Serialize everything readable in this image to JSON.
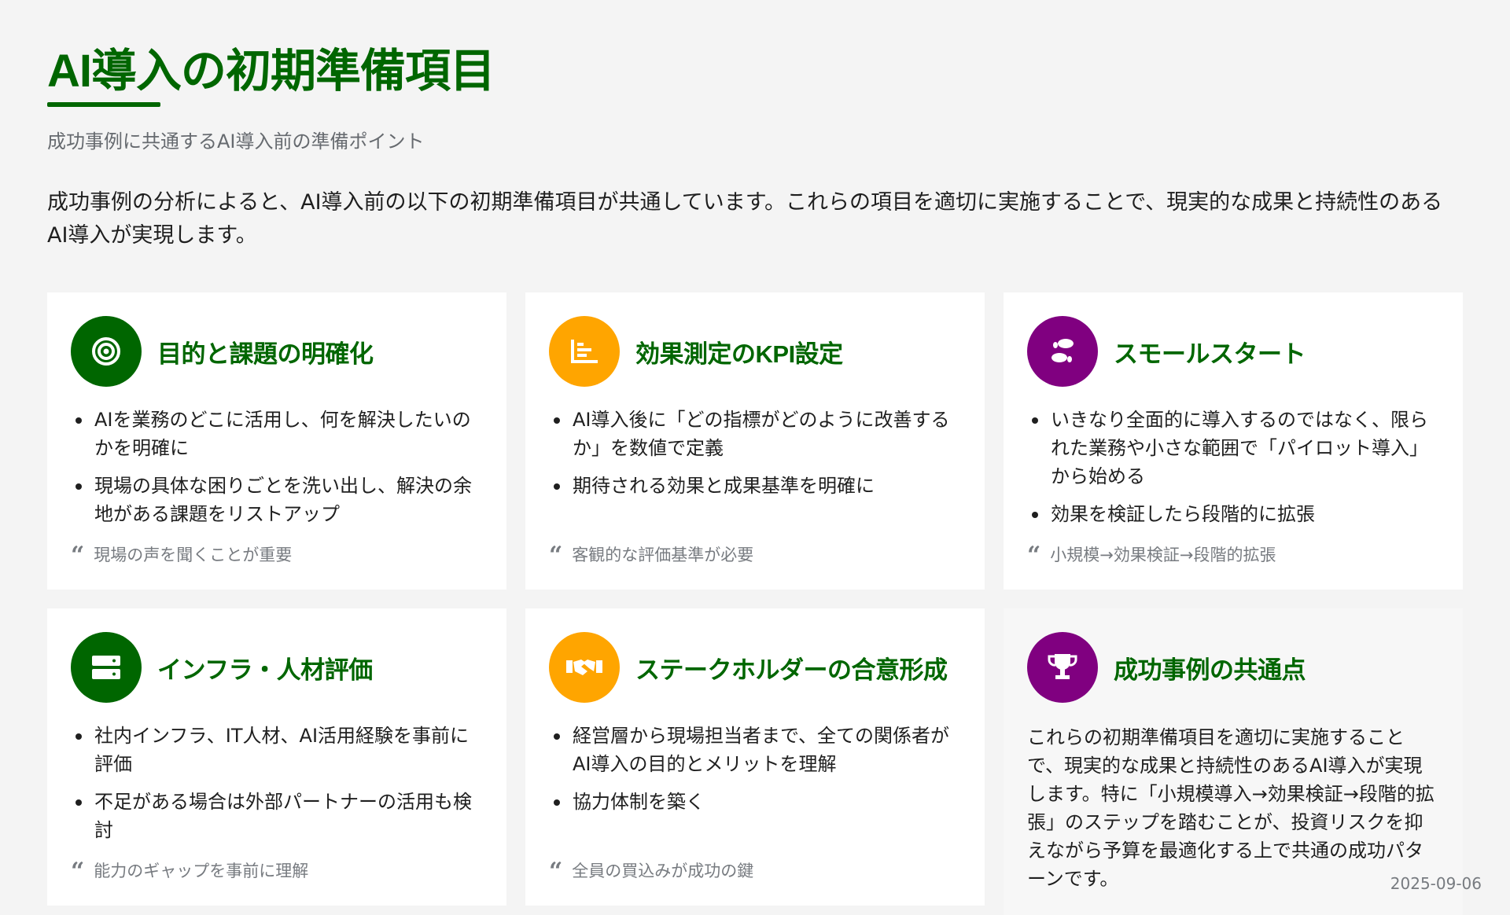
{
  "header": {
    "title": "AI導入の初期準備項目",
    "subtitle": "成功事例に共通するAI導入前の準備ポイント",
    "intro": "成功事例の分析によると、AI導入前の以下の初期準備項目が共通しています。これらの項目を適切に実施することで、現実的な成果と持続性のあるAI導入が実現します。"
  },
  "colors": {
    "green": "#006600",
    "orange": "#ffa500",
    "purple": "#800080"
  },
  "cards": [
    {
      "icon": "target-icon",
      "color": "green",
      "title": "目的と課題の明確化",
      "bullets": [
        "AIを業務のどこに活用し、何を解決したいのかを明確に",
        "現場の具体な困りごとを洗い出し、解決の余地がある課題をリストアップ"
      ],
      "quote": "現場の声を聞くことが重要"
    },
    {
      "icon": "chart-icon",
      "color": "orange",
      "title": "効果測定のKPI設定",
      "bullets": [
        "AI導入後に「どの指標がどのように改善するか」を数値で定義",
        "期待される効果と成果基準を明確に"
      ],
      "quote": "客観的な評価基準が必要"
    },
    {
      "icon": "footprints-icon",
      "color": "purple",
      "title": "スモールスタート",
      "bullets": [
        "いきなり全面的に導入するのではなく、限られた業務や小さな範囲で「パイロット導入」から始める",
        "効果を検証したら段階的に拡張"
      ],
      "quote": "小規模→効果検証→段階的拡張"
    },
    {
      "icon": "server-icon",
      "color": "green",
      "title": "インフラ・人材評価",
      "bullets": [
        "社内インフラ、IT人材、AI活用経験を事前に評価",
        "不足がある場合は外部パートナーの活用も検討"
      ],
      "quote": "能力のギャップを事前に理解"
    },
    {
      "icon": "handshake-icon",
      "color": "orange",
      "title": "ステークホルダーの合意形成",
      "bullets": [
        "経営層から現場担当者まで、全ての関係者がAI導入の目的とメリットを理解",
        "協力体制を築く"
      ],
      "quote": "全員の買込みが成功の鍵"
    },
    {
      "icon": "trophy-icon",
      "color": "purple",
      "title": "成功事例の共通点",
      "summary": "これらの初期準備項目を適切に実施することで、現実的な成果と持続性のあるAI導入が実現します。特に「小規模導入→効果検証→段階的拡張」のステップを踏むことが、投資リスクを抑えながら予算を最適化する上で共通の成功パターンです。"
    }
  ],
  "footer": {
    "date": "2025-09-06"
  }
}
